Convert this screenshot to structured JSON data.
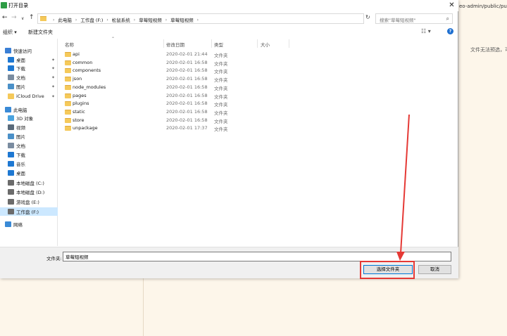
{
  "background": {
    "url_fragment": "eo-admin/public/publ",
    "note": "文件无法预选，可"
  },
  "dialog": {
    "title": "打开目录",
    "close_glyph": "✕"
  },
  "nav": {
    "back_glyph": "←",
    "forward_glyph": "→",
    "dropdown_glyph": "∨",
    "up_glyph": "↑",
    "breadcrumbs": [
      "此电脑",
      "工作盘 (F:)",
      "松鼠系统",
      "草莓短视频",
      "草莓短视频"
    ],
    "search_placeholder": "搜索\"草莓短视频\""
  },
  "toolbar": {
    "organize": "组织 ▾",
    "new_folder": "新建文件夹"
  },
  "sidebar": {
    "items": [
      {
        "label": "快速访问",
        "icon": "star-icon",
        "color": "#3a7fd5",
        "pinned": false,
        "indent": 0
      },
      {
        "label": "桌面",
        "icon": "desktop-icon",
        "color": "#1e78d2",
        "pinned": true,
        "indent": 1
      },
      {
        "label": "下载",
        "icon": "download-icon",
        "color": "#1e78d2",
        "pinned": true,
        "indent": 1
      },
      {
        "label": "文档",
        "icon": "document-icon",
        "color": "#7a8ca0",
        "pinned": true,
        "indent": 1
      },
      {
        "label": "图片",
        "icon": "picture-icon",
        "color": "#4a90c8",
        "pinned": true,
        "indent": 1
      },
      {
        "label": "iCloud Drive",
        "icon": "folder-icon",
        "color": "#f5c95a",
        "pinned": true,
        "indent": 1
      },
      {
        "label": "此电脑",
        "icon": "computer-icon",
        "color": "#3a8ad6",
        "pinned": false,
        "indent": 0
      },
      {
        "label": "3D 对象",
        "icon": "3d-objects-icon",
        "color": "#4aa3df",
        "pinned": false,
        "indent": 1
      },
      {
        "label": "视频",
        "icon": "video-icon",
        "color": "#5a6a7a",
        "pinned": false,
        "indent": 1
      },
      {
        "label": "图片",
        "icon": "picture-icon",
        "color": "#4a90c8",
        "pinned": false,
        "indent": 1
      },
      {
        "label": "文档",
        "icon": "document-icon",
        "color": "#7a8ca0",
        "pinned": false,
        "indent": 1
      },
      {
        "label": "下载",
        "icon": "download-icon",
        "color": "#1e78d2",
        "pinned": false,
        "indent": 1
      },
      {
        "label": "音乐",
        "icon": "music-icon",
        "color": "#1e78d2",
        "pinned": false,
        "indent": 1
      },
      {
        "label": "桌面",
        "icon": "desktop-icon",
        "color": "#1e78d2",
        "pinned": false,
        "indent": 1
      },
      {
        "label": "本地磁盘 (C:)",
        "icon": "drive-icon",
        "color": "#6b6b6b",
        "pinned": false,
        "indent": 1
      },
      {
        "label": "本地磁盘 (D:)",
        "icon": "drive-icon",
        "color": "#6b6b6b",
        "pinned": false,
        "indent": 1
      },
      {
        "label": "游戏盘 (E:)",
        "icon": "drive-icon",
        "color": "#6b6b6b",
        "pinned": false,
        "indent": 1
      },
      {
        "label": "工作盘 (F:)",
        "icon": "drive-icon",
        "color": "#6b6b6b",
        "pinned": false,
        "indent": 1,
        "selected": true
      },
      {
        "label": "网络",
        "icon": "network-icon",
        "color": "#3a8ad6",
        "pinned": false,
        "indent": 0
      }
    ],
    "pin_glyph": "📌"
  },
  "list": {
    "columns": {
      "name": "名称",
      "date": "修改日期",
      "type": "类型",
      "size": "大小"
    },
    "rows": [
      {
        "name": "api",
        "date": "2020-02-01 21:44",
        "type": "文件夹"
      },
      {
        "name": "common",
        "date": "2020-02-01 16:58",
        "type": "文件夹"
      },
      {
        "name": "components",
        "date": "2020-02-01 16:58",
        "type": "文件夹"
      },
      {
        "name": "json",
        "date": "2020-02-01 16:58",
        "type": "文件夹"
      },
      {
        "name": "node_modules",
        "date": "2020-02-01 16:58",
        "type": "文件夹"
      },
      {
        "name": "pages",
        "date": "2020-02-01 16:58",
        "type": "文件夹"
      },
      {
        "name": "plugins",
        "date": "2020-02-01 16:58",
        "type": "文件夹"
      },
      {
        "name": "static",
        "date": "2020-02-01 16:58",
        "type": "文件夹"
      },
      {
        "name": "store",
        "date": "2020-02-01 16:58",
        "type": "文件夹"
      },
      {
        "name": "unpackage",
        "date": "2020-02-01 17:37",
        "type": "文件夹"
      }
    ]
  },
  "footer": {
    "folder_label": "文件夹:",
    "folder_value": "草莓短视频",
    "select_button": "选择文件夹",
    "cancel_button": "取消"
  },
  "annotation": {
    "color": "#e53935"
  }
}
